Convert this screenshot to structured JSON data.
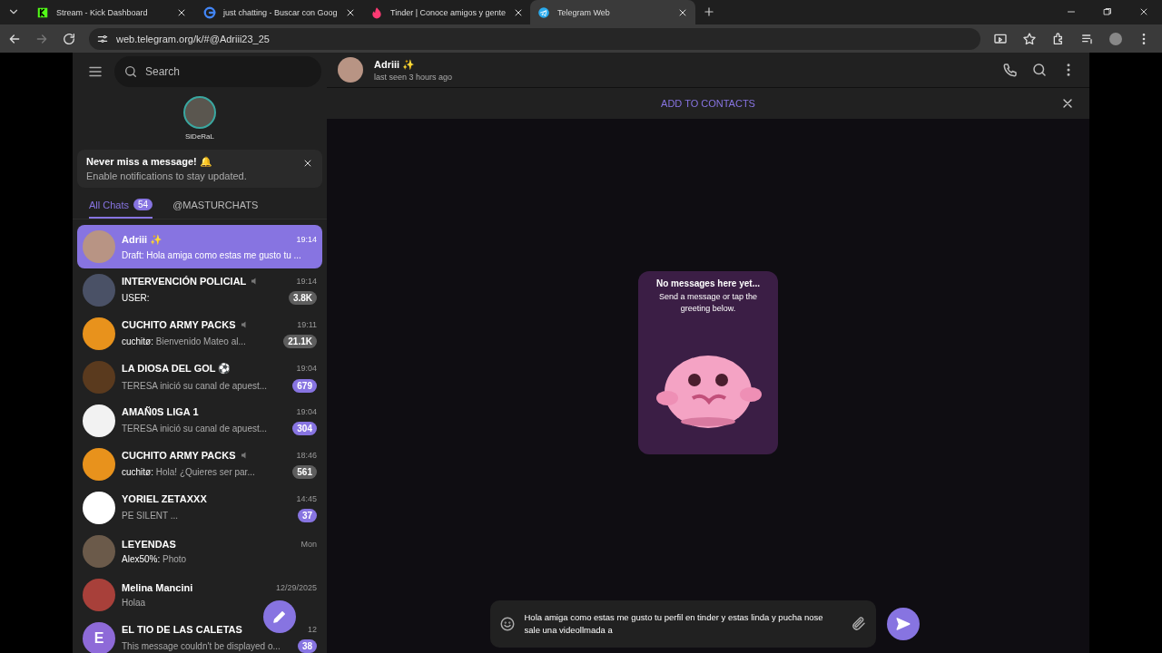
{
  "browser": {
    "tabs": [
      {
        "title": "Stream - Kick Dashboard",
        "selected": false
      },
      {
        "title": "just chatting - Buscar con Goog",
        "selected": false
      },
      {
        "title": "Tinder | Conoce amigos y gente",
        "selected": false
      },
      {
        "title": "Telegram Web",
        "selected": true
      }
    ],
    "url": "web.telegram.org/k/#@Adriii23_25"
  },
  "sidebar": {
    "search": {
      "placeholder": "Search"
    },
    "story": {
      "name": "SiDeRaL"
    },
    "notice": {
      "title": "Never miss a message! 🔔",
      "text": "Enable notifications to stay updated."
    },
    "folders": [
      {
        "label": "All Chats",
        "count": "54",
        "selected": true
      },
      {
        "label": "@MASTURCHATS",
        "selected": false
      }
    ],
    "chats": [
      {
        "name": "Adriii ✨",
        "time": "19:14",
        "sender": "Draft:",
        "preview": "Hola amiga como estas me gusto tu ...",
        "selected": true,
        "muted": false
      },
      {
        "name": "INTERVENCIÓN POLICIAL",
        "time": "19:14",
        "sender": "USER:",
        "badge": "3.8K",
        "muted": true,
        "selected": false
      },
      {
        "name": "CUCHITO ARMY PACKS",
        "time": "19:11",
        "sender": "cuchitø:",
        "preview": "Bienvenido Mateo al...",
        "badge": "21.1K",
        "muted": true,
        "selected": false
      },
      {
        "name": "LA DIOSA DEL GOL ⚽",
        "time": "19:04",
        "preview": "TERESA inició su canal de apuest...",
        "badge": "679",
        "muted": false,
        "selected": false
      },
      {
        "name": "AMAÑ0S LIGA 1",
        "time": "19:04",
        "preview": "TERESA inició su canal de apuest...",
        "badge": "304",
        "muted": false,
        "selected": false
      },
      {
        "name": "CUCHITO ARMY PACKS",
        "time": "18:46",
        "sender": "cuchitø:",
        "preview": "Hola! ¿Quieres ser par...",
        "badge": "561",
        "muted": true,
        "selected": false
      },
      {
        "name": "YORIEL ZETAXXX",
        "time": "14:45",
        "preview": "PE SILENT ...",
        "badge": "37",
        "muted": false,
        "selected": false
      },
      {
        "name": "LEYENDAS",
        "time": "Mon",
        "sender": "Alex50%:",
        "preview": "Photo",
        "muted": false,
        "selected": false
      },
      {
        "name": "Melina Mancini",
        "time": "12/29/2025",
        "preview": "Holaa",
        "muted": false,
        "selected": false
      },
      {
        "name": "EL TIO DE LAS CALETAS",
        "time": "12",
        "preview": "This message couldn't be displayed o...",
        "badge": "38",
        "muted": false,
        "selected": false,
        "initial": "E"
      }
    ]
  },
  "chat": {
    "name": "Adriii ✨",
    "status": "last seen 3 hours ago",
    "banner": "ADD TO CONTACTS",
    "empty": {
      "title": "No messages here yet...",
      "text": "Send a message or tap the greeting below."
    },
    "draft": "Hola amiga como estas me gusto tu perfil en tinder y estas linda y pucha nose sale una videollmada a"
  }
}
